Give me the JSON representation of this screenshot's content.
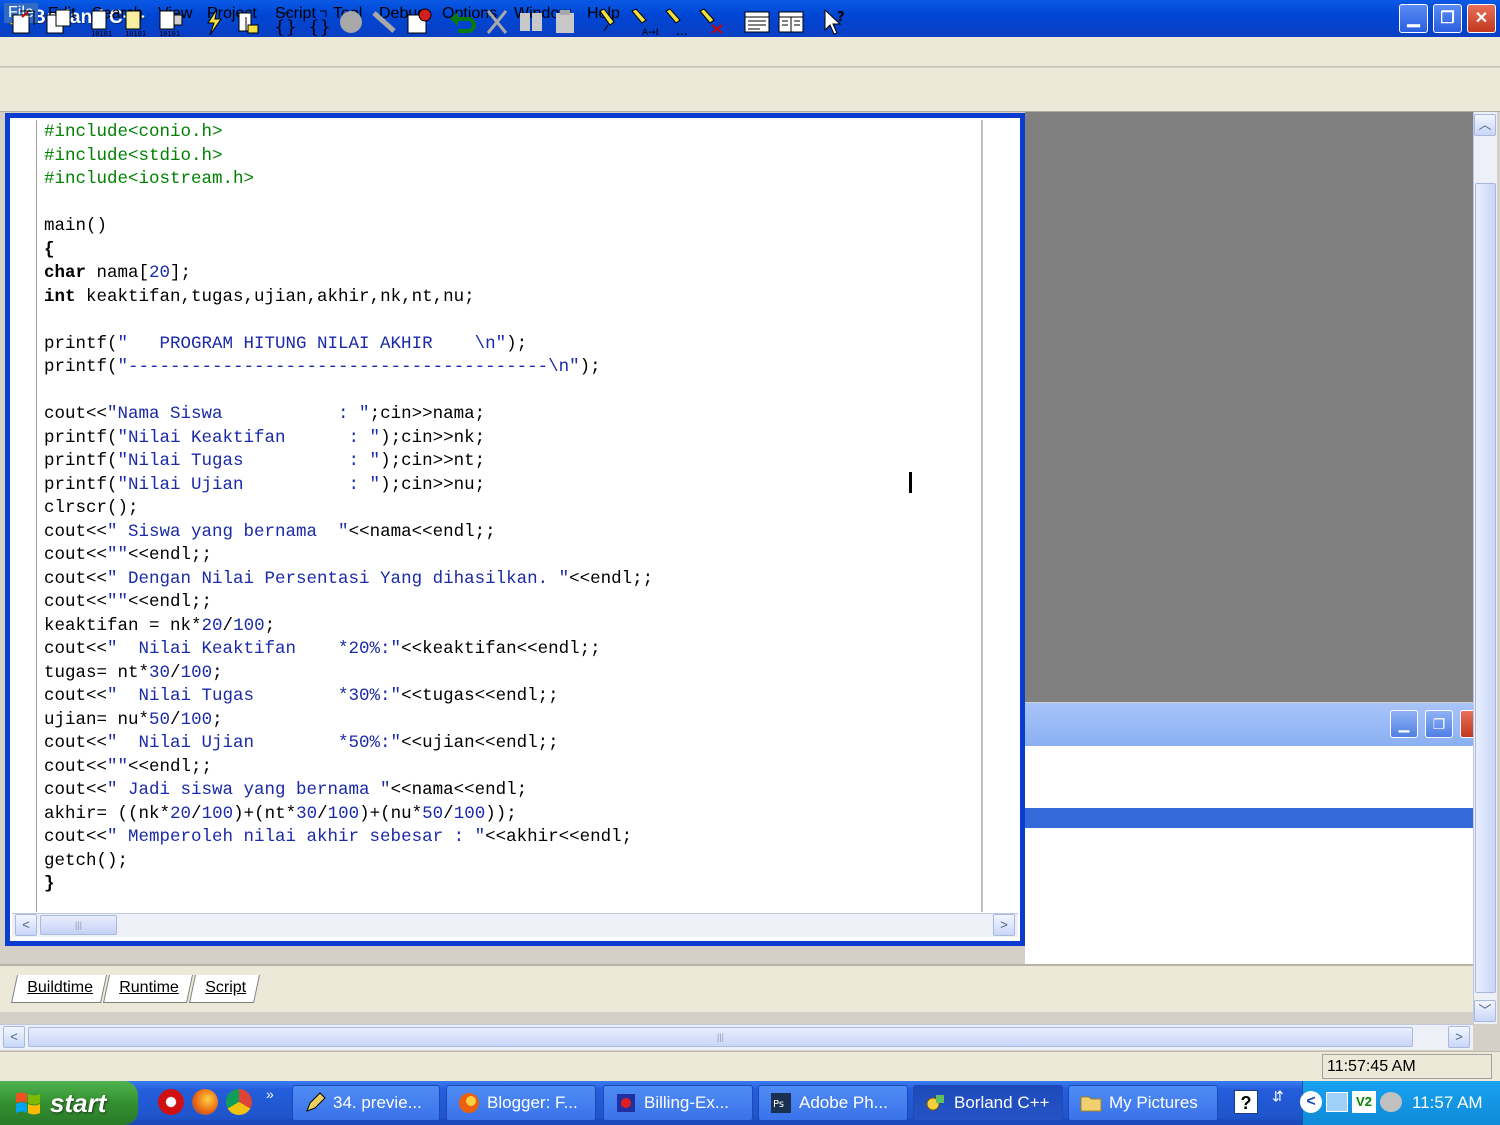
{
  "window": {
    "title": "Borland C++"
  },
  "menu": [
    "File",
    "Edit",
    "Search",
    "View",
    "Project",
    "Script",
    "Tool",
    "Debug",
    "Options",
    "Window",
    "Help"
  ],
  "editor": {
    "lines": [
      [
        [
          "pp",
          "#include<conio.h>"
        ]
      ],
      [
        [
          "pp",
          "#include<stdio.h>"
        ]
      ],
      [
        [
          "pp",
          "#include<iostream.h>"
        ]
      ],
      [],
      [
        [
          "n",
          "main()"
        ]
      ],
      [
        [
          "kw",
          "{"
        ]
      ],
      [
        [
          "kw",
          "char"
        ],
        [
          "n",
          " nama["
        ],
        [
          "num",
          "20"
        ],
        [
          "n",
          "];"
        ]
      ],
      [
        [
          "kw",
          "int"
        ],
        [
          "n",
          " keaktifan,tugas,ujian,akhir,nk,nt,nu;"
        ]
      ],
      [],
      [
        [
          "n",
          "printf("
        ],
        [
          "str",
          "\"   PROGRAM HITUNG NILAI AKHIR    \\n\""
        ],
        [
          "n",
          ");"
        ]
      ],
      [
        [
          "n",
          "printf("
        ],
        [
          "str",
          "\"----------------------------------------\\n\""
        ],
        [
          "n",
          ");"
        ]
      ],
      [],
      [
        [
          "n",
          "cout<<"
        ],
        [
          "str",
          "\"Nama Siswa           : \""
        ],
        [
          "n",
          ";cin>>nama;"
        ]
      ],
      [
        [
          "n",
          "printf("
        ],
        [
          "str",
          "\"Nilai Keaktifan      : \""
        ],
        [
          "n",
          ");cin>>nk;"
        ]
      ],
      [
        [
          "n",
          "printf("
        ],
        [
          "str",
          "\"Nilai Tugas          : \""
        ],
        [
          "n",
          ");cin>>nt;"
        ]
      ],
      [
        [
          "n",
          "printf("
        ],
        [
          "str",
          "\"Nilai Ujian          : \""
        ],
        [
          "n",
          ");cin>>nu;"
        ]
      ],
      [
        [
          "n",
          "clrscr();"
        ]
      ],
      [
        [
          "n",
          "cout<<"
        ],
        [
          "str",
          "\" Siswa yang bernama  \""
        ],
        [
          "n",
          "<<nama<<endl;;"
        ]
      ],
      [
        [
          "n",
          "cout<<"
        ],
        [
          "str",
          "\"\""
        ],
        [
          "n",
          "<<endl;;"
        ]
      ],
      [
        [
          "n",
          "cout<<"
        ],
        [
          "str",
          "\" Dengan Nilai Persentasi Yang dihasilkan. \""
        ],
        [
          "n",
          "<<endl;;"
        ]
      ],
      [
        [
          "n",
          "cout<<"
        ],
        [
          "str",
          "\"\""
        ],
        [
          "n",
          "<<endl;;"
        ]
      ],
      [
        [
          "n",
          "keaktifan = nk*"
        ],
        [
          "num",
          "20"
        ],
        [
          "n",
          "/"
        ],
        [
          "num",
          "100"
        ],
        [
          "n",
          ";"
        ]
      ],
      [
        [
          "n",
          "cout<<"
        ],
        [
          "str",
          "\"  Nilai Keaktifan    *20%:\""
        ],
        [
          "n",
          "<<keaktifan<<endl;;"
        ]
      ],
      [
        [
          "n",
          "tugas= nt*"
        ],
        [
          "num",
          "30"
        ],
        [
          "n",
          "/"
        ],
        [
          "num",
          "100"
        ],
        [
          "n",
          ";"
        ]
      ],
      [
        [
          "n",
          "cout<<"
        ],
        [
          "str",
          "\"  Nilai Tugas        *30%:\""
        ],
        [
          "n",
          "<<tugas<<endl;;"
        ]
      ],
      [
        [
          "n",
          "ujian= nu*"
        ],
        [
          "num",
          "50"
        ],
        [
          "n",
          "/"
        ],
        [
          "num",
          "100"
        ],
        [
          "n",
          ";"
        ]
      ],
      [
        [
          "n",
          "cout<<"
        ],
        [
          "str",
          "\"  Nilai Ujian        *50%:\""
        ],
        [
          "n",
          "<<ujian<<endl;;"
        ]
      ],
      [
        [
          "n",
          "cout<<"
        ],
        [
          "str",
          "\"\""
        ],
        [
          "n",
          "<<endl;;"
        ]
      ],
      [
        [
          "n",
          "cout<<"
        ],
        [
          "str",
          "\" Jadi siswa yang bernama \""
        ],
        [
          "n",
          "<<nama<<endl;"
        ]
      ],
      [
        [
          "n",
          "akhir= ((nk*"
        ],
        [
          "num",
          "20"
        ],
        [
          "n",
          "/"
        ],
        [
          "num",
          "100"
        ],
        [
          "n",
          ")+(nt*"
        ],
        [
          "num",
          "30"
        ],
        [
          "n",
          "/"
        ],
        [
          "num",
          "100"
        ],
        [
          "n",
          ")+(nu*"
        ],
        [
          "num",
          "50"
        ],
        [
          "n",
          "/"
        ],
        [
          "num",
          "100"
        ],
        [
          "n",
          "));"
        ]
      ],
      [
        [
          "n",
          "cout<<"
        ],
        [
          "str",
          "\" Memperoleh nilai akhir sebesar : \""
        ],
        [
          "n",
          "<<akhir<<endl;"
        ]
      ],
      [
        [
          "n",
          "getch();"
        ]
      ],
      [
        [
          "kw",
          "}"
        ]
      ]
    ]
  },
  "tabs": [
    "Buildtime",
    "Runtime",
    "Script"
  ],
  "statusbar": {
    "time": "11:57:45 AM"
  },
  "taskbar": {
    "start": "start",
    "tasks": [
      "34. previe...",
      "Blogger: F...",
      "Billing-Ex...",
      "Adobe Ph...",
      "Borland C++",
      "My Pictures"
    ],
    "active_task": 4,
    "clock": "11:57 AM"
  },
  "colors": {
    "editor_frame": "#0a3cd0",
    "preprocessor": "#008000",
    "string": "#1a2aa8",
    "taskbar": "#245edb"
  }
}
